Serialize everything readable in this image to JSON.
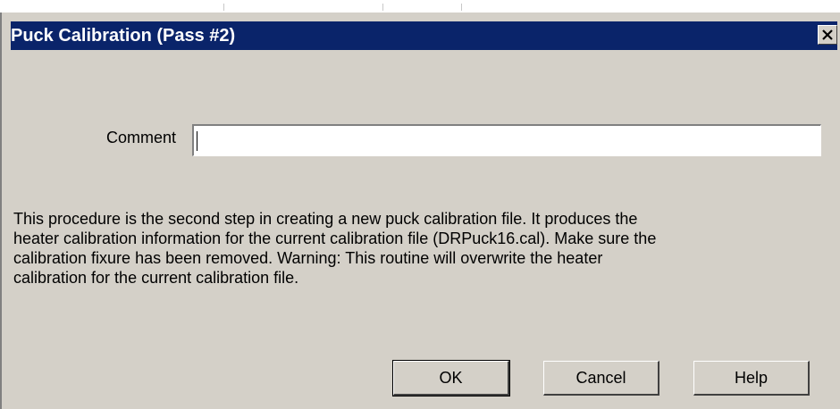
{
  "window": {
    "title": "Puck Calibration (Pass #2)"
  },
  "form": {
    "comment_label": "Comment",
    "comment_value": ""
  },
  "description": "This procedure is the second step in creating a new puck calibration file.  It produces the\nheater calibration information for the current calibration file (DRPuck16.cal).  Make sure the\ncalibration fixure has been removed.  Warning: This routine will overwrite the heater\ncalibration for the current calibration file.",
  "buttons": {
    "ok": "OK",
    "cancel": "Cancel",
    "help": "Help"
  },
  "icons": {
    "close": "close-icon"
  },
  "colors": {
    "titlebar": "#0a246a",
    "dialog_face": "#d4d0c8"
  }
}
